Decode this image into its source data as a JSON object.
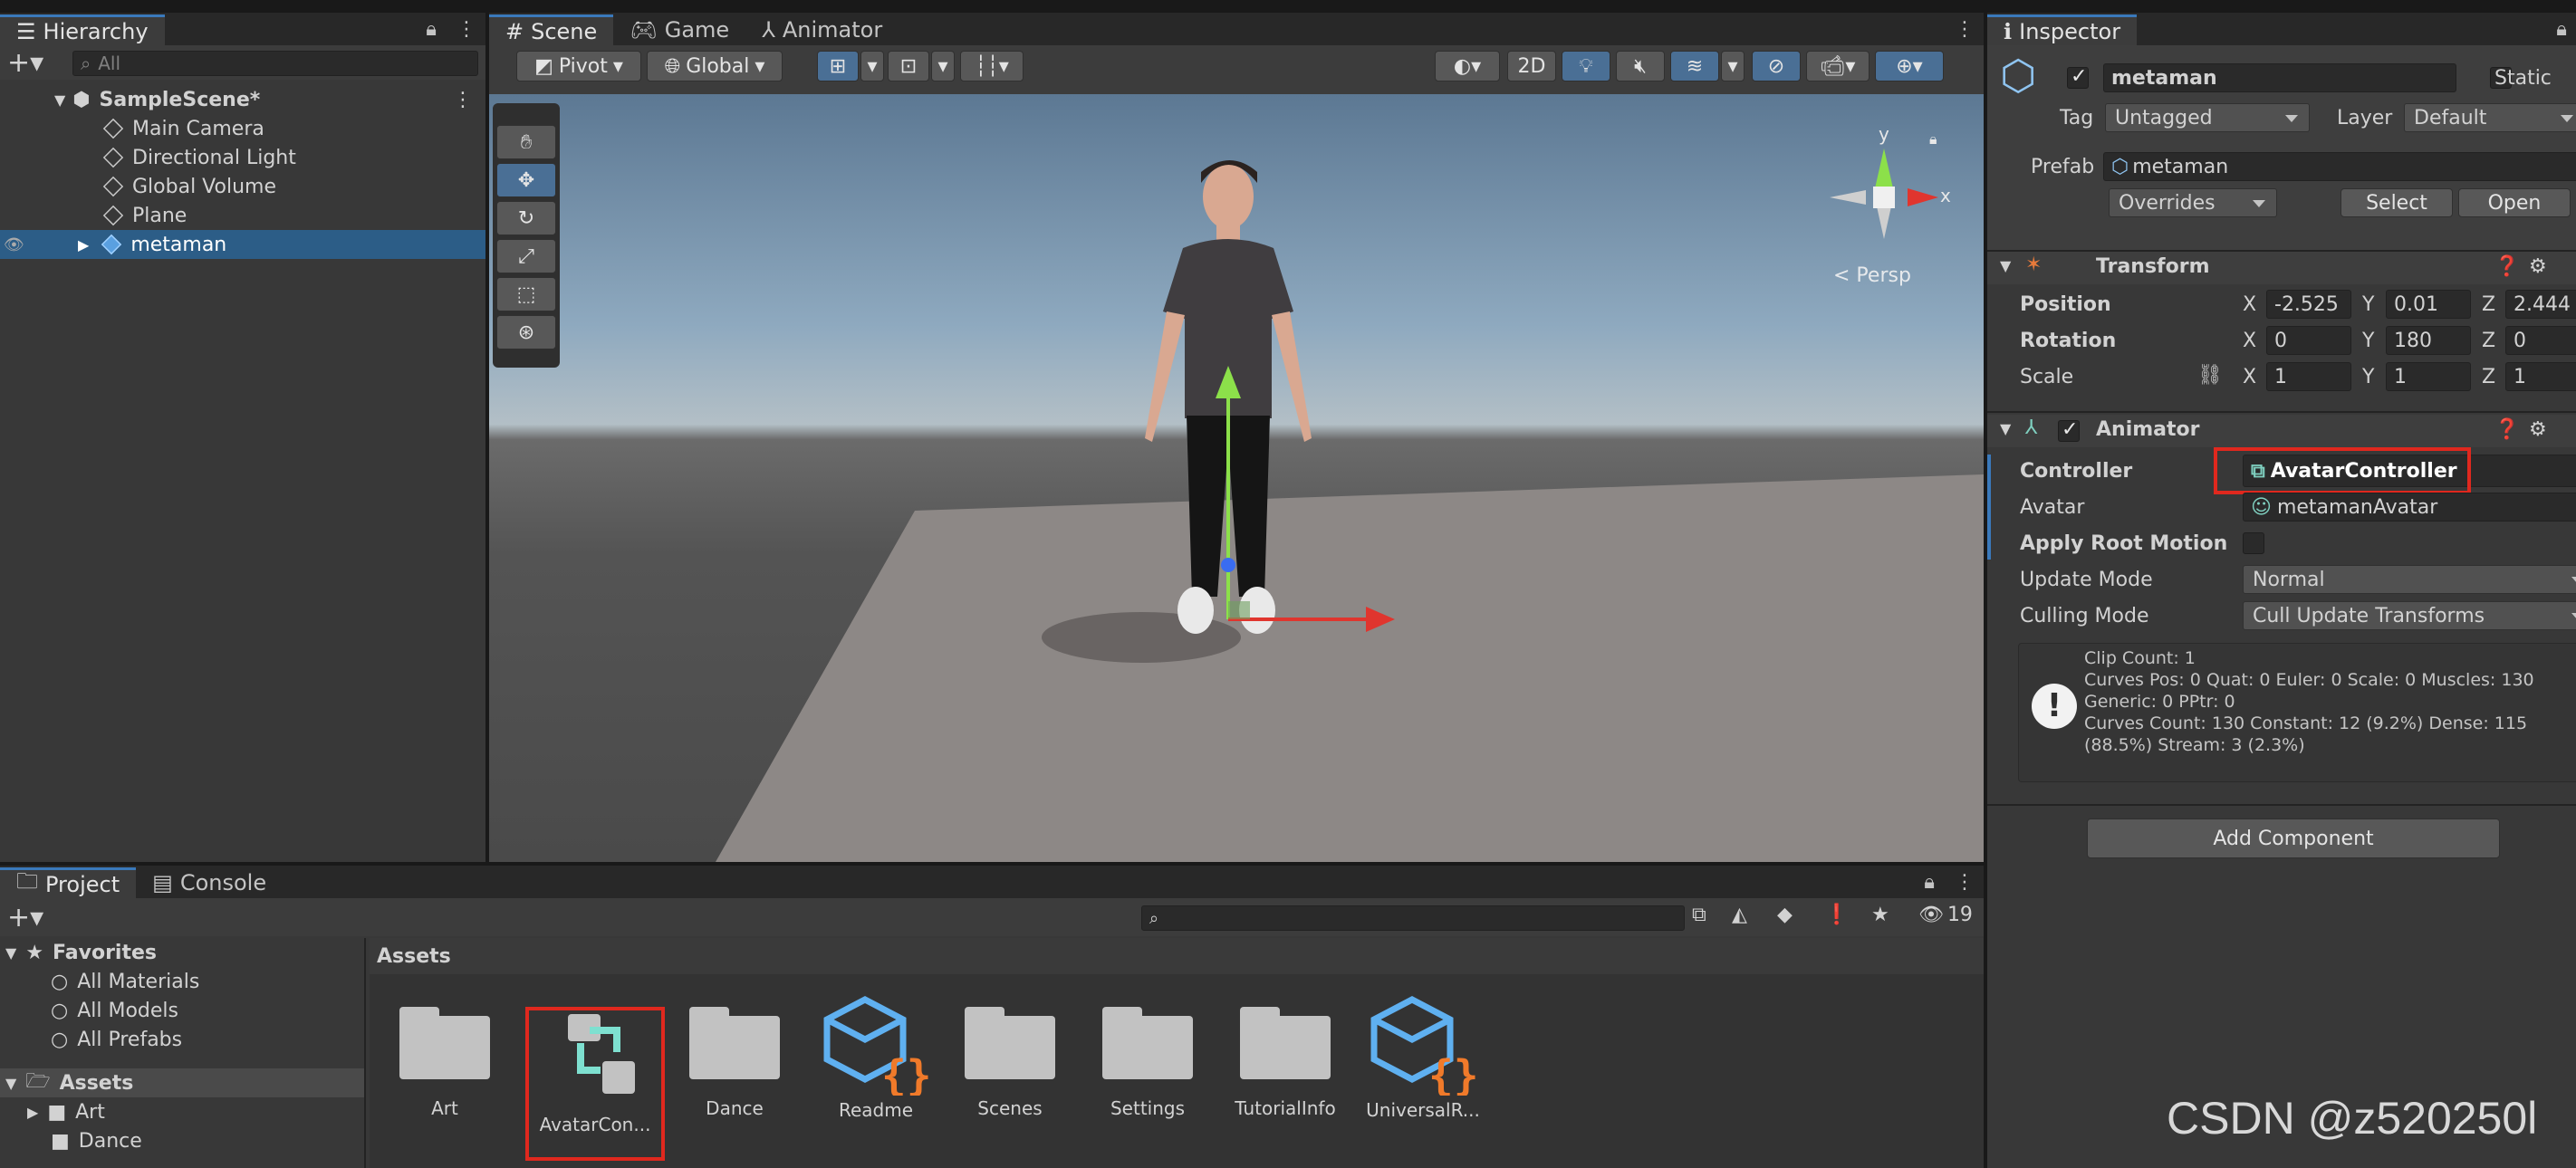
{
  "hierarchy": {
    "tab": "Hierarchy",
    "search_placeholder": "All",
    "scene": "SampleScene*",
    "items": [
      "Main Camera",
      "Directional Light",
      "Global Volume",
      "Plane",
      "metaman"
    ]
  },
  "scene_view": {
    "tabs": [
      "Scene",
      "Game",
      "Animator"
    ],
    "pivot": "Pivot",
    "global": "Global",
    "btn_2d": "2D",
    "gizmo_y": "y",
    "gizmo_x": "x",
    "persp": "< Persp"
  },
  "inspector": {
    "tab": "Inspector",
    "object_name": "metaman",
    "static_label": "Static",
    "tag_label": "Tag",
    "tag_value": "Untagged",
    "layer_label": "Layer",
    "layer_value": "Default",
    "prefab_label": "Prefab",
    "prefab_value": "metaman",
    "overrides": "Overrides",
    "select": "Select",
    "open": "Open",
    "transform": {
      "title": "Transform",
      "position_label": "Position",
      "position": [
        "-2.525",
        "0.01",
        "2.444"
      ],
      "rotation_label": "Rotation",
      "rotation": [
        "0",
        "180",
        "0"
      ],
      "scale_label": "Scale",
      "scale": [
        "1",
        "1",
        "1"
      ],
      "x": "X",
      "y": "Y",
      "z": "Z"
    },
    "animator": {
      "title": "Animator",
      "controller_label": "Controller",
      "controller_value": "AvatarController",
      "avatar_label": "Avatar",
      "avatar_value": "metamanAvatar",
      "root_motion_label": "Apply Root Motion",
      "update_mode_label": "Update Mode",
      "update_mode_value": "Normal",
      "culling_mode_label": "Culling Mode",
      "culling_mode_value": "Cull Update Transforms",
      "info_lines": [
        "Clip Count: 1",
        "Curves Pos: 0 Quat: 0 Euler: 0 Scale: 0 Muscles: 130",
        "Generic: 0 PPtr: 0",
        "Curves Count: 130 Constant: 12 (9.2%) Dense: 115",
        "(88.5%) Stream: 3 (2.3%)"
      ]
    },
    "add_component": "Add Component"
  },
  "project": {
    "tabs": [
      "Project",
      "Console"
    ],
    "hidden_count": "19",
    "favorites_label": "Favorites",
    "favorites": [
      "All Materials",
      "All Models",
      "All Prefabs"
    ],
    "assets_label": "Assets",
    "tree": [
      "Art",
      "Dance"
    ],
    "breadcrumb": "Assets",
    "assets": [
      "Art",
      "AvatarCon...",
      "Dance",
      "Readme",
      "Scenes",
      "Settings",
      "TutorialInfo",
      "UniversalR..."
    ]
  },
  "watermark": "CSDN @z520250l",
  "colors": {
    "accent": "#3a79bb",
    "selection": "#2c5d87",
    "highlight_box": "#e0281e"
  }
}
